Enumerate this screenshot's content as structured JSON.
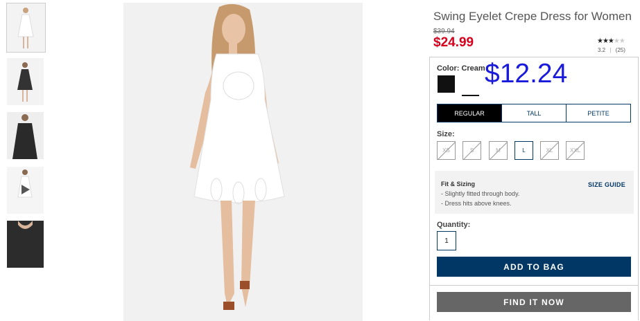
{
  "product": {
    "title": "Swing Eyelet Crepe Dress for Women",
    "original_price": "$39.94",
    "sale_price": "$24.99",
    "rating_value": 3.2,
    "rating_text": "3.2",
    "review_count": "(25)",
    "overlay_price": "$12.24"
  },
  "thumbnails": [
    {
      "name": "front-view",
      "selected": true
    },
    {
      "name": "back-view",
      "selected": false
    },
    {
      "name": "print-view",
      "selected": false
    },
    {
      "name": "video",
      "selected": false
    },
    {
      "name": "detail-view",
      "selected": false
    }
  ],
  "color": {
    "label": "Color:",
    "selected": "Cream",
    "swatches": [
      {
        "name": "black",
        "hex": "#111111"
      },
      {
        "name": "cream",
        "hex": "#ffffff",
        "selected": true
      }
    ]
  },
  "fit_tabs": [
    {
      "label": "REGULAR",
      "active": true
    },
    {
      "label": "TALL",
      "active": false
    },
    {
      "label": "PETITE",
      "active": false
    }
  ],
  "size": {
    "label": "Size:",
    "options": [
      {
        "label": "XS",
        "available": false
      },
      {
        "label": "S",
        "available": false
      },
      {
        "label": "M",
        "available": false
      },
      {
        "label": "L",
        "available": true
      },
      {
        "label": "XL",
        "available": false
      },
      {
        "label": "XXL",
        "available": false
      }
    ]
  },
  "fit_sizing": {
    "title": "Fit & Sizing",
    "lines": [
      "- Slightly fitted through body.",
      "- Dress hits above knees."
    ],
    "guide_link": "SIZE GUIDE"
  },
  "quantity": {
    "label": "Quantity:",
    "value": "1"
  },
  "buttons": {
    "add_to_bag": "ADD TO BAG",
    "find_it_now": "FIND IT NOW"
  },
  "colors": {
    "sale_red": "#d6001c",
    "navy": "#003764",
    "overlay_blue": "#1a1adb",
    "gray_button": "#666666"
  }
}
